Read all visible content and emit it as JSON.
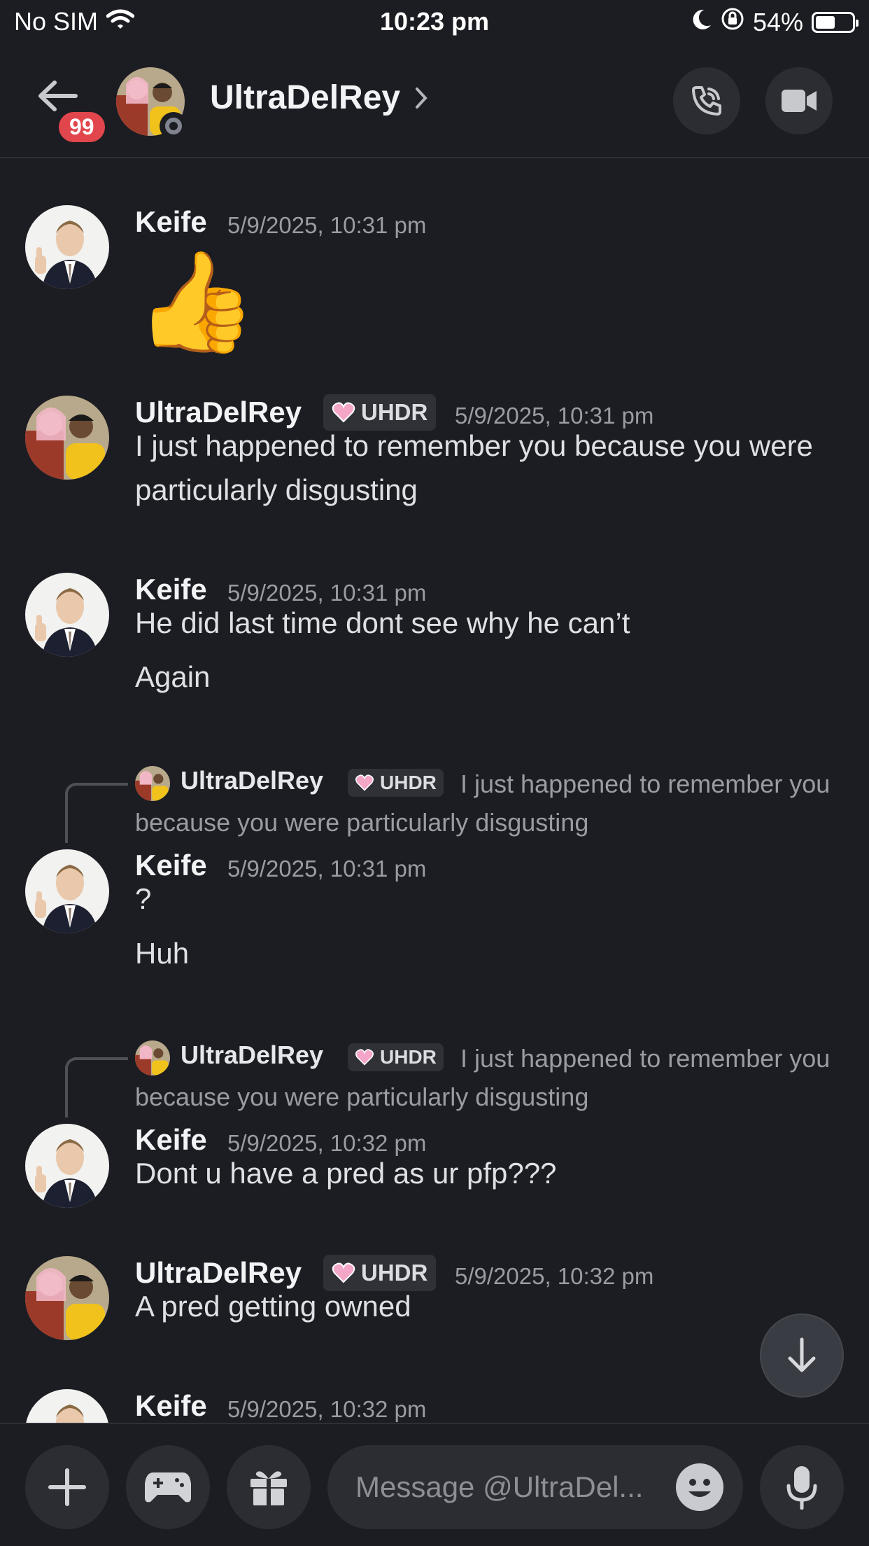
{
  "status_bar": {
    "carrier": "No SIM",
    "time": "10:23 pm",
    "battery": "54%",
    "battery_level": 0.54
  },
  "header": {
    "unread_count": "99",
    "channel_name": "UltraDelRey",
    "icons": [
      "back-arrow-icon",
      "chevron-right-icon",
      "phone-call-icon",
      "video-camera-icon"
    ]
  },
  "messages": [
    {
      "author": "Keife",
      "timestamp": "5/9/2025, 10:31 pm",
      "content": "👍"
    },
    {
      "author": "UltraDelRey",
      "tag": "UHDR",
      "timestamp": "5/9/2025, 10:31 pm",
      "content": "I just happened to remember you because you were particularly disgusting"
    },
    {
      "author": "Keife",
      "timestamp": "5/9/2025, 10:31 pm",
      "content": "He did last time dont see why he can’t",
      "content2": "Again"
    },
    {
      "reply": {
        "author": "UltraDelRey",
        "tag": "UHDR",
        "text": "I just happened to remember you because you were particularly disgusting"
      },
      "author": "Keife",
      "timestamp": "5/9/2025, 10:31 pm",
      "content": "?",
      "content2": "Huh"
    },
    {
      "reply": {
        "author": "UltraDelRey",
        "tag": "UHDR",
        "text": "I just happened to remember you because you were particularly disgusting"
      },
      "author": "Keife",
      "timestamp": "5/9/2025, 10:32 pm",
      "content": "Dont u have a pred as ur pfp???"
    },
    {
      "author": "UltraDelRey",
      "tag": "UHDR",
      "timestamp": "5/9/2025, 10:32 pm",
      "content": "A pred getting owned"
    },
    {
      "author": "Keife",
      "timestamp": "5/9/2025, 10:32 pm"
    }
  ],
  "composer": {
    "placeholder": "Message @UltraDel..."
  },
  "colors": {
    "background": "#1c1d22",
    "badge_red": "#e1464c",
    "tag_bg": "#2f3137",
    "heart_pink": "#f4a6c8"
  }
}
